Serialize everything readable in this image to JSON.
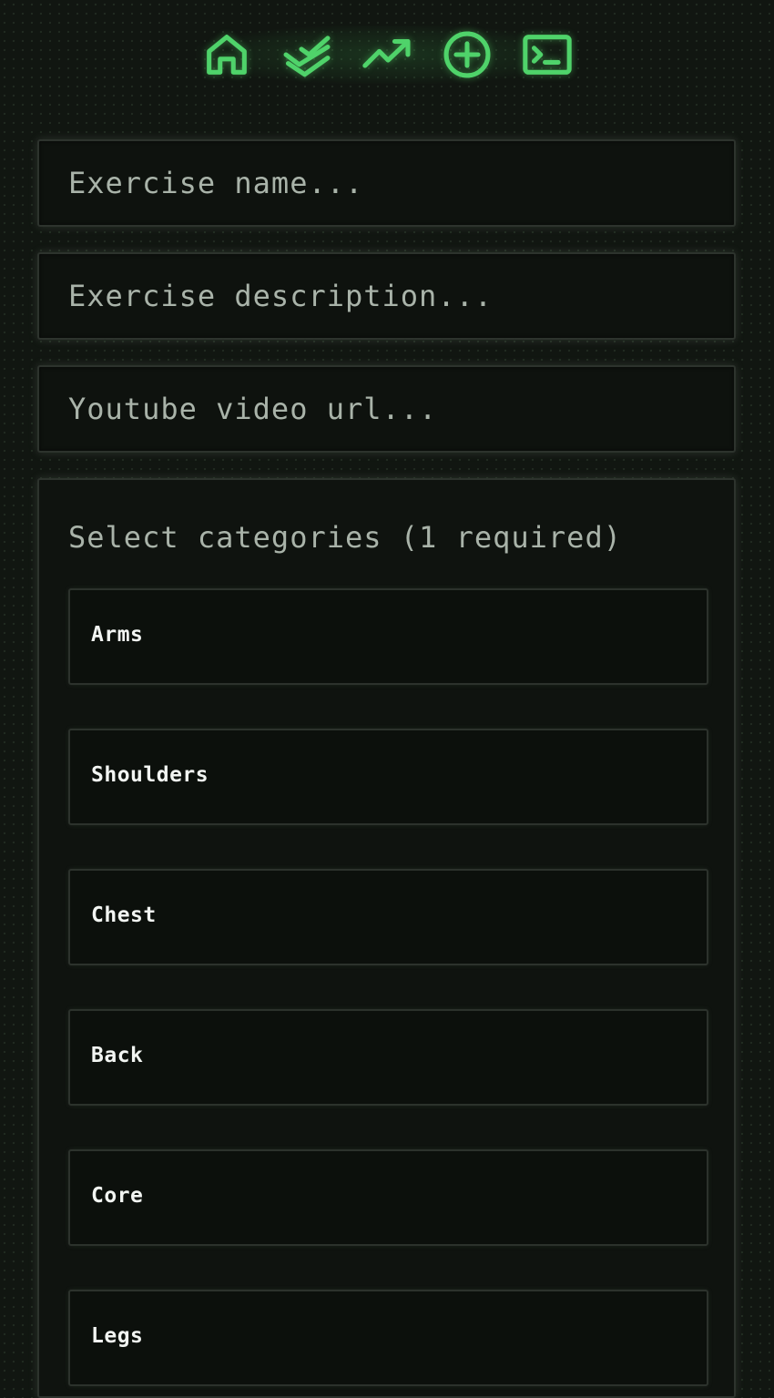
{
  "nav": {
    "items": [
      {
        "name": "home-icon"
      },
      {
        "name": "double-check-icon"
      },
      {
        "name": "trend-up-icon"
      },
      {
        "name": "plus-circle-icon"
      },
      {
        "name": "terminal-icon"
      }
    ],
    "accent_color": "#4fd36a"
  },
  "form": {
    "name_field": {
      "placeholder": "Exercise name...",
      "value": ""
    },
    "description_field": {
      "placeholder": "Exercise description...",
      "value": ""
    },
    "video_field": {
      "placeholder": "Youtube video url...",
      "value": ""
    }
  },
  "categories": {
    "title": "Select categories (1 required)",
    "items": [
      {
        "label": "Arms"
      },
      {
        "label": "Shoulders"
      },
      {
        "label": "Chest"
      },
      {
        "label": "Back"
      },
      {
        "label": "Core"
      },
      {
        "label": "Legs"
      }
    ]
  }
}
